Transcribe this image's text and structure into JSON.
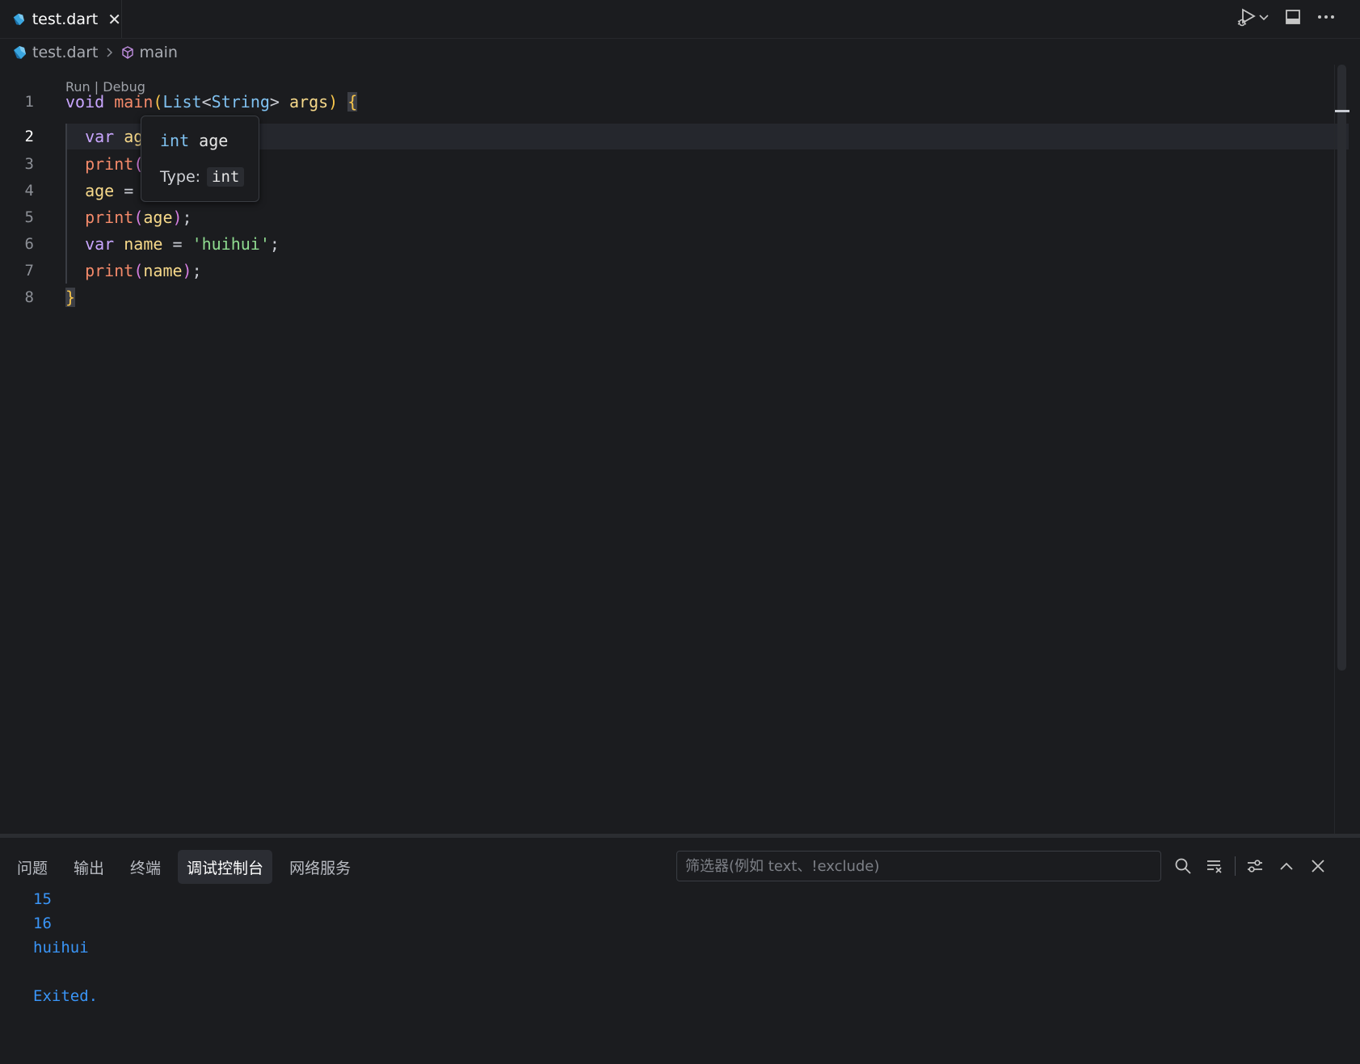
{
  "tab": {
    "label": "test.dart",
    "close": "✕"
  },
  "breadcrumb": {
    "file": "test.dart",
    "symbol": "main"
  },
  "editor": {
    "codelens": {
      "run": "Run",
      "sep": " | ",
      "debug": "Debug"
    },
    "line_numbers": [
      "1",
      "2",
      "3",
      "4",
      "5",
      "6",
      "7",
      "8"
    ],
    "active_line": 2,
    "code": {
      "l1": {
        "kw": "void",
        "fn": "main",
        "open": "(",
        "type1": "List",
        "lt": "<",
        "type2": "String",
        "gt": ">",
        "param": "args",
        "close": ")",
        "brace": "{"
      },
      "l2": {
        "kw": "var",
        "name": "ag"
      },
      "l3": {
        "fn": "print",
        "open": "("
      },
      "l4": {
        "name": "age",
        "op": " ="
      },
      "l5": {
        "fn": "print",
        "open": "(",
        "arg": "age",
        "close": ")",
        "semi": ";"
      },
      "l6": {
        "kw": "var",
        "name": "name",
        "op": " = ",
        "str": "'huihui'",
        "semi": ";"
      },
      "l7": {
        "fn": "print",
        "open": "(",
        "arg": "name",
        "close": ")",
        "semi": ";"
      },
      "l8": {
        "brace": "}"
      }
    },
    "hover": {
      "sig_type": "int",
      "sig_name": " age",
      "type_label": "Type:",
      "type_value": "int"
    }
  },
  "panel": {
    "tabs": [
      {
        "label": "问题"
      },
      {
        "label": "输出"
      },
      {
        "label": "终端"
      },
      {
        "label": "调试控制台",
        "active": true
      },
      {
        "label": "网络服务"
      }
    ],
    "filter_placeholder": "筛选器(例如 text、!exclude)",
    "output": [
      "15",
      "16",
      "huihui",
      "",
      "Exited."
    ]
  },
  "colors": {
    "background": "#1b1c1f",
    "output": "#3a95f7",
    "keyword": "#c9a6ff",
    "function": "#f48a6a",
    "type": "#7fc1f0",
    "string": "#8fdc90"
  }
}
